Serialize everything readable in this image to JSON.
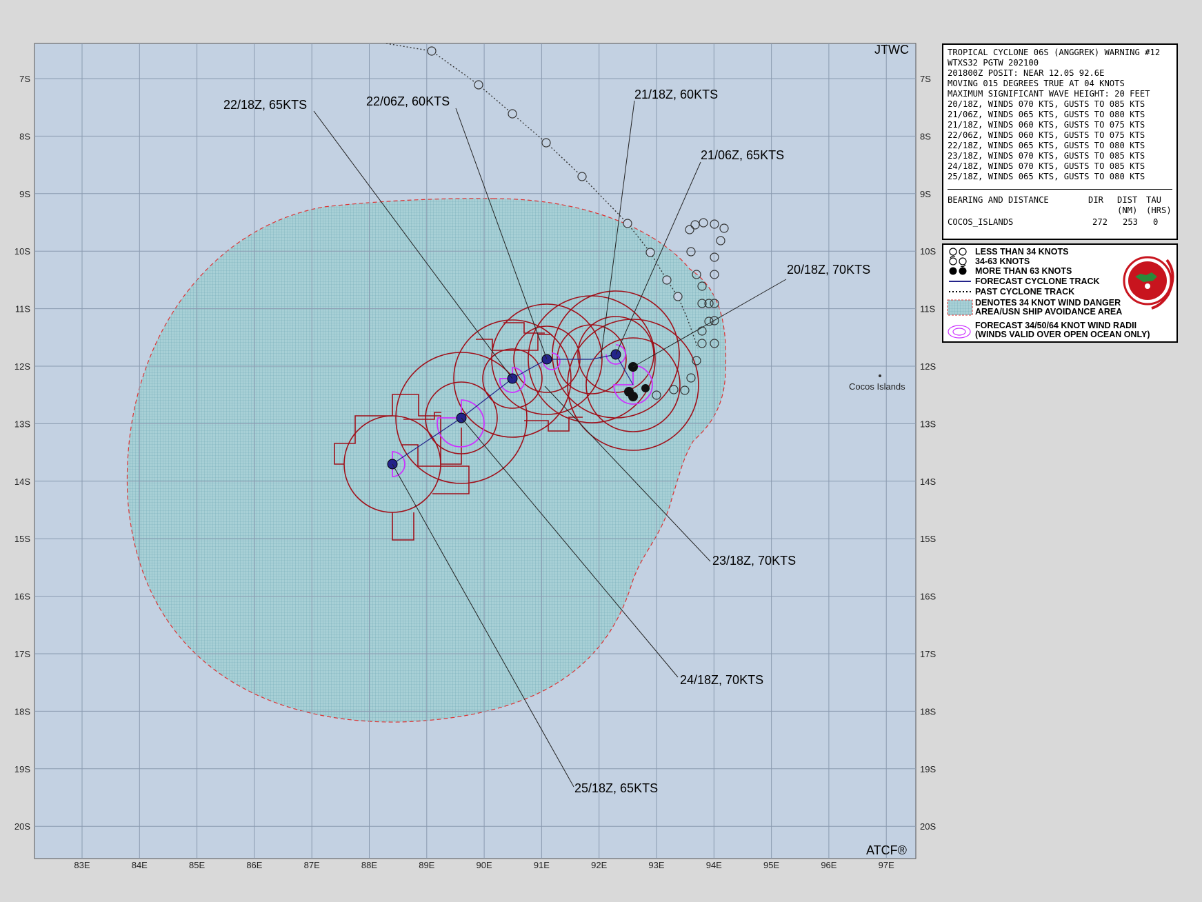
{
  "map": {
    "corner_labels": {
      "agency": "JTWC",
      "software": "ATCF®"
    },
    "lon_ticks": [
      "83E",
      "84E",
      "85E",
      "86E",
      "87E",
      "88E",
      "89E",
      "90E",
      "91E",
      "92E",
      "93E",
      "94E",
      "95E",
      "96E",
      "97E"
    ],
    "lat_ticks": [
      "7S",
      "8S",
      "9S",
      "10S",
      "11S",
      "12S",
      "13S",
      "14S",
      "15S",
      "16S",
      "17S",
      "18S",
      "19S",
      "20S"
    ],
    "place_label": "Cocos Islands",
    "colors": {
      "ocean": "#c3d1e2",
      "danger_area": "#a8d0d6",
      "wind_radii": "#a0101a",
      "inner_radii": "#cc33ff",
      "storm_center": "#23238a"
    }
  },
  "forecast_labels": [
    {
      "time": "20/18Z",
      "text": "20/18Z,  70KTS"
    },
    {
      "time": "21/06Z",
      "text": "21/06Z,  65KTS"
    },
    {
      "time": "21/18Z",
      "text": "21/18Z,  60KTS"
    },
    {
      "time": "22/06Z",
      "text": "22/06Z,  60KTS"
    },
    {
      "time": "22/18Z",
      "text": "22/18Z,  65KTS"
    },
    {
      "time": "23/18Z",
      "text": "23/18Z,  70KTS"
    },
    {
      "time": "24/18Z",
      "text": "24/18Z,  70KTS"
    },
    {
      "time": "25/18Z",
      "text": "25/18Z,  65KTS"
    }
  ],
  "warning": {
    "lines": [
      "TROPICAL CYCLONE 06S (ANGGREK) WARNING #12",
      "WTXS32 PGTW 202100",
      "201800Z POSIT: NEAR 12.0S 92.6E",
      "MOVING 015 DEGREES TRUE AT 04 KNOTS",
      "MAXIMUM SIGNIFICANT WAVE HEIGHT: 20 FEET",
      "20/18Z, WINDS 070 KTS, GUSTS TO 085 KTS",
      "21/06Z, WINDS 065 KTS, GUSTS TO 080 KTS",
      "21/18Z, WINDS 060 KTS, GUSTS TO 075 KTS",
      "22/06Z, WINDS 060 KTS, GUSTS TO 075 KTS",
      "22/18Z, WINDS 065 KTS, GUSTS TO 080 KTS",
      "23/18Z, WINDS 070 KTS, GUSTS TO 085 KTS",
      "24/18Z, WINDS 070 KTS, GUSTS TO 085 KTS",
      "25/18Z, WINDS 065 KTS, GUSTS TO 080 KTS"
    ],
    "bearing": {
      "header": "BEARING AND DISTANCE",
      "col_dir": "DIR",
      "col_dist": "DIST",
      "col_tau": "TAU",
      "col_dist_unit": "(NM)",
      "col_tau_unit": "(HRS)",
      "place": "COCOS_ISLANDS",
      "dir": "272",
      "dist": "253",
      "tau": "0"
    }
  },
  "legend": {
    "items": [
      "LESS THAN 34 KNOTS",
      "34-63 KNOTS",
      "MORE THAN 63 KNOTS",
      "FORECAST CYCLONE TRACK",
      "PAST CYCLONE TRACK",
      "DENOTES 34 KNOT WIND DANGER\nAREA/USN SHIP AVOIDANCE AREA",
      "FORECAST 34/50/64 KNOT WIND RADII\n(WINDS VALID OVER OPEN OCEAN ONLY)"
    ]
  },
  "track": {
    "forecast": [
      {
        "time": "20/18Z",
        "lat": -12.0,
        "lon": 92.6
      },
      {
        "time": "21/06Z",
        "lat": -11.8,
        "lon": 92.3
      },
      {
        "time": "21/18Z",
        "lat": -11.9,
        "lon": 91.5
      },
      {
        "time": "22/06Z",
        "lat": -11.85,
        "lon": 91.1
      },
      {
        "time": "22/18Z",
        "lat": -12.2,
        "lon": 90.5
      },
      {
        "time": "23/18Z",
        "lat": -12.9,
        "lon": 89.6
      },
      {
        "time": "24/18Z",
        "lat": -13.7,
        "lon": 88.4
      }
    ]
  }
}
